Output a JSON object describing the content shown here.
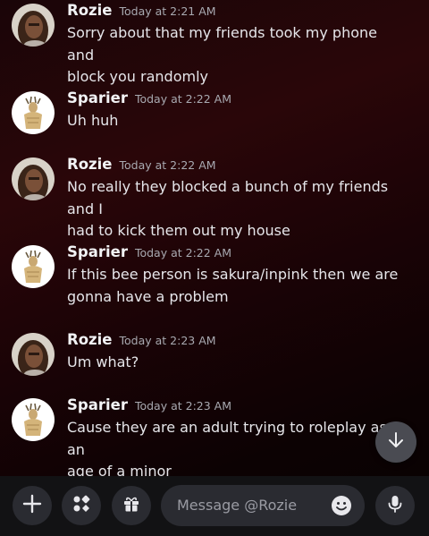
{
  "messages": [
    {
      "author": "Rozie",
      "time": "Today at 2:21 AM",
      "lines": [
        "Sorry about that my friends took my phone and",
        "block you randomly"
      ]
    },
    {
      "author": "Sparier",
      "time": "Today at 2:22 AM",
      "lines": [
        "Uh huh"
      ]
    },
    {
      "author": "Rozie",
      "time": "Today at 2:22 AM",
      "lines": [
        "No really they blocked a bunch of my friends and I",
        "had to kick them out my house"
      ]
    },
    {
      "author": "Sparier",
      "time": "Today at 2:22 AM",
      "lines": [
        "If this bee person is sakura/inpink then we are",
        "gonna have a problem"
      ]
    },
    {
      "author": "Rozie",
      "time": "Today at 2:23 AM",
      "lines": [
        "Um what?"
      ]
    },
    {
      "author": "Sparier",
      "time": "Today at 2:23 AM",
      "lines": [
        "Cause they are an adult trying to roleplay as an",
        "age of a minor"
      ]
    }
  ],
  "composer": {
    "placeholder": "Message @Rozie",
    "buttons": [
      "plus-icon",
      "apps-icon",
      "gift-icon",
      "emoji-icon",
      "microphone-icon"
    ]
  },
  "scroll_button_icon": "arrow-down-icon",
  "colors": {
    "background_accent": "#2a0609",
    "composer_bg": "#121214",
    "button_bg": "#2a2b31",
    "timestamp": "#a8a9b0"
  }
}
